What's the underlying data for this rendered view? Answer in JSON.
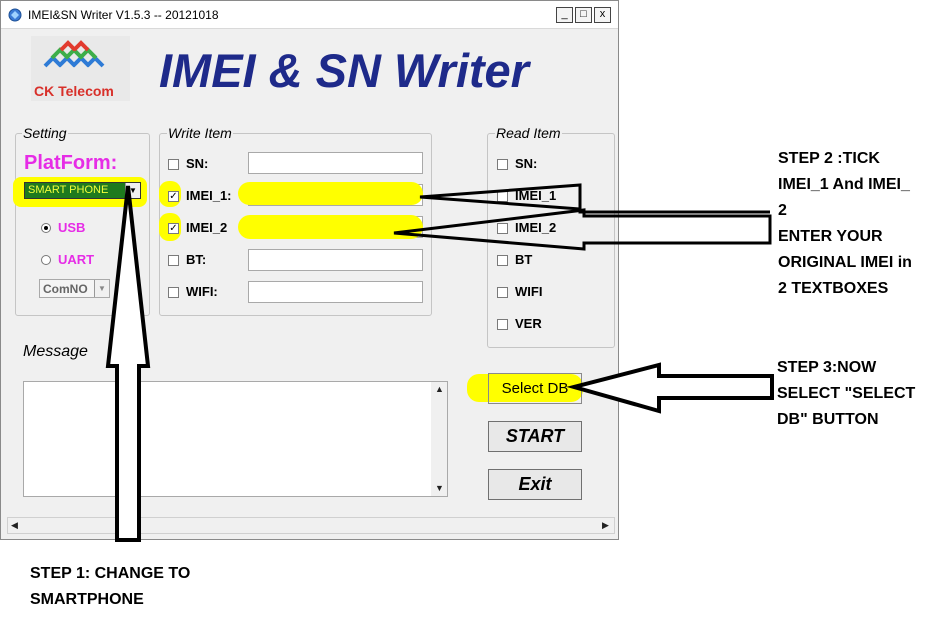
{
  "window": {
    "title": "IMEI&SN Writer V1.5.3 -- 20121018",
    "controls": [
      "_",
      "□",
      "x"
    ]
  },
  "logo": {
    "text": "CK Telecom"
  },
  "heading": "IMEI & SN Writer",
  "setting": {
    "legend": "Setting",
    "platform_label": "PlatForm:",
    "platform_value": "SMART PHONE",
    "options": [
      {
        "label": "USB",
        "selected": true
      },
      {
        "label": "UART",
        "selected": false
      }
    ],
    "com_port": "ComNO"
  },
  "write_item": {
    "legend": "Write Item",
    "items": [
      {
        "label": "SN:",
        "checked": false,
        "value": ""
      },
      {
        "label": "IMEI_1:",
        "checked": true,
        "value": ""
      },
      {
        "label": "IMEI_2",
        "checked": true,
        "value": ""
      },
      {
        "label": "BT:",
        "checked": false,
        "value": ""
      },
      {
        "label": "WIFI:",
        "checked": false,
        "value": ""
      }
    ]
  },
  "read_item": {
    "legend": "Read Item",
    "items": [
      {
        "label": "SN:",
        "checked": false
      },
      {
        "label": "IMEI_1",
        "checked": false
      },
      {
        "label": "IMEI_2",
        "checked": false
      },
      {
        "label": "BT",
        "checked": false
      },
      {
        "label": "WIFI",
        "checked": false
      },
      {
        "label": "VER",
        "checked": false
      }
    ]
  },
  "message": {
    "label": "Message",
    "value": ""
  },
  "buttons": {
    "select_db": "Select DB",
    "start": "START",
    "exit": "Exit"
  },
  "annotations": {
    "step1": [
      "STEP 1: CHANGE TO",
      "SMARTPHONE"
    ],
    "step2": [
      "STEP 2 :TICK",
      "IMEI_1 And IMEI_",
      "2",
      "ENTER YOUR",
      "ORIGINAL IMEI in",
      "2 TEXTBOXES"
    ],
    "step3": [
      "STEP 3:NOW",
      "SELECT \"SELECT",
      "DB\" BUTTON"
    ]
  },
  "colors": {
    "heading": "#1e2a8a",
    "platform_text": "#e62ce6",
    "highlight": "#ffff00",
    "select_bg": "#1e7a1e",
    "logo_text": "#d8302a"
  }
}
